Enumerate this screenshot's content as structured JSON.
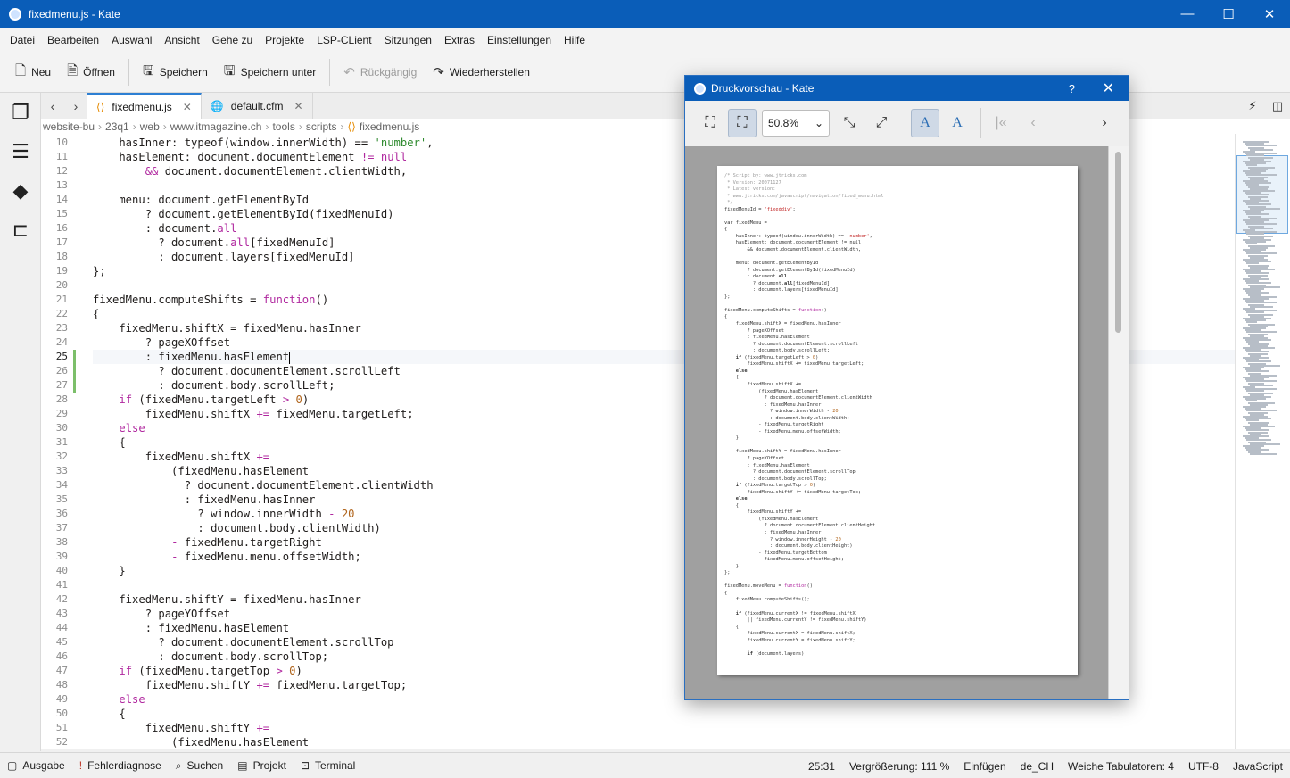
{
  "window": {
    "title": "fixedmenu.js  - Kate",
    "controls": [
      "—",
      "☐",
      "✕"
    ]
  },
  "menu": [
    "Datei",
    "Bearbeiten",
    "Auswahl",
    "Ansicht",
    "Gehe zu",
    "Projekte",
    "LSP-CLient",
    "Sitzungen",
    "Extras",
    "Einstellungen",
    "Hilfe"
  ],
  "toolbar": {
    "new": "Neu",
    "open": "Öffnen",
    "save": "Speichern",
    "save_as": "Speichern unter",
    "undo": "Rückgängig",
    "redo": "Wiederherstellen"
  },
  "tabs": [
    {
      "label": "fixedmenu.js",
      "active": true,
      "icon": "code-file-icon"
    },
    {
      "label": "default.cfm",
      "active": false,
      "icon": "web-file-icon"
    }
  ],
  "breadcrumb": [
    "website-bu",
    "23q1",
    "web",
    "www.itmagazine.ch",
    "tools",
    "scripts",
    "fixedmenu.js"
  ],
  "editor": {
    "current_line": 25,
    "lines": [
      {
        "n": 10,
        "html": "    hasInner: typeof(window.innerWidth) == <span class=\"str\">'number'</span>,"
      },
      {
        "n": 11,
        "html": "    hasElement: document.documentElement <span class=\"kw\">!=</span> <span class=\"kw\">null</span>"
      },
      {
        "n": 12,
        "html": "        <span class=\"kw\">&amp;&amp;</span> document.documentElement.clientWidth,"
      },
      {
        "n": 13,
        "html": ""
      },
      {
        "n": 14,
        "html": "    menu: document.getElementById"
      },
      {
        "n": 15,
        "html": "        ? document.getElementById(fixedMenuId)"
      },
      {
        "n": 16,
        "html": "        : document.<span class=\"kw\">all</span>"
      },
      {
        "n": 17,
        "html": "          ? document.<span class=\"kw\">all</span>[fixedMenuId]"
      },
      {
        "n": 18,
        "html": "          : document.layers[fixedMenuId]"
      },
      {
        "n": 19,
        "html": "};"
      },
      {
        "n": 20,
        "html": ""
      },
      {
        "n": 21,
        "html": "fixedMenu.computeShifts = <span class=\"kw\">function</span>()"
      },
      {
        "n": 22,
        "html": "{"
      },
      {
        "n": 23,
        "html": "    fixedMenu.shiftX = fixedMenu.hasInner"
      },
      {
        "n": 24,
        "html": "        ? pageXOffset"
      },
      {
        "n": 25,
        "html": "        : fixedMenu.hasElement<span class=\"caret\"></span>"
      },
      {
        "n": 26,
        "html": "          ? document.documentElement.scrollLeft"
      },
      {
        "n": 27,
        "html": "          : document.body.scrollLeft;"
      },
      {
        "n": 28,
        "html": "    <span class=\"kw\">if</span> (fixedMenu.targetLeft <span class=\"kw\">&gt;</span> <span class=\"num\">0</span>)"
      },
      {
        "n": 29,
        "html": "        fixedMenu.shiftX <span class=\"kw\">+=</span> fixedMenu.targetLeft;"
      },
      {
        "n": 30,
        "html": "    <span class=\"kw\">else</span>"
      },
      {
        "n": 31,
        "html": "    {"
      },
      {
        "n": 32,
        "html": "        fixedMenu.shiftX <span class=\"kw\">+=</span>"
      },
      {
        "n": 33,
        "html": "            (fixedMenu.hasElement"
      },
      {
        "n": 34,
        "html": "              ? document.documentElement.clientWidth"
      },
      {
        "n": 35,
        "html": "              : fixedMenu.hasInner"
      },
      {
        "n": 36,
        "html": "                ? window.innerWidth <span class=\"kw\">-</span> <span class=\"num\">20</span>"
      },
      {
        "n": 37,
        "html": "                : document.body.clientWidth)"
      },
      {
        "n": 38,
        "html": "            <span class=\"kw\">-</span> fixedMenu.targetRight"
      },
      {
        "n": 39,
        "html": "            <span class=\"kw\">-</span> fixedMenu.menu.offsetWidth;"
      },
      {
        "n": 40,
        "html": "    }"
      },
      {
        "n": 41,
        "html": ""
      },
      {
        "n": 42,
        "html": "    fixedMenu.shiftY = fixedMenu.hasInner"
      },
      {
        "n": 43,
        "html": "        ? pageYOffset"
      },
      {
        "n": 44,
        "html": "        : fixedMenu.hasElement"
      },
      {
        "n": 45,
        "html": "          ? document.documentElement.scrollTop"
      },
      {
        "n": 46,
        "html": "          : document.body.scrollTop;"
      },
      {
        "n": 47,
        "html": "    <span class=\"kw\">if</span> (fixedMenu.targetTop <span class=\"kw\">&gt;</span> <span class=\"num\">0</span>)"
      },
      {
        "n": 48,
        "html": "        fixedMenu.shiftY <span class=\"kw\">+=</span> fixedMenu.targetTop;"
      },
      {
        "n": 49,
        "html": "    <span class=\"kw\">else</span>"
      },
      {
        "n": 50,
        "html": "    {"
      },
      {
        "n": 51,
        "html": "        fixedMenu.shiftY <span class=\"kw\">+=</span>"
      },
      {
        "n": 52,
        "html": "            (fixedMenu.hasElement"
      }
    ]
  },
  "preview": {
    "title": "Druckvorschau - Kate",
    "help": "?",
    "close": "✕",
    "zoom": "50.8%",
    "lines": [
      {
        "c": true,
        "html": "/* Script by: www.jtricks.com"
      },
      {
        "c": true,
        "html": " * Version: 20071127"
      },
      {
        "c": true,
        "html": " * Latest version:"
      },
      {
        "c": true,
        "html": " * www.jtricks.com/javascript/navigation/fixed_menu.html"
      },
      {
        "c": true,
        "html": " */"
      },
      {
        "html": "fixedMenuId = <span class=\"str\">'fixeddiv'</span>;"
      },
      {
        "html": ""
      },
      {
        "html": "var fixedMenu ="
      },
      {
        "html": "{"
      },
      {
        "html": "    hasInner: typeof(window.innerWidth) == <span class=\"str\">'number'</span>,"
      },
      {
        "html": "    hasElement: document.documentElement != null"
      },
      {
        "html": "        &amp;&amp; document.documentElement.clientWidth,"
      },
      {
        "html": ""
      },
      {
        "html": "    menu: document.getElementById"
      },
      {
        "html": "        ? document.getElementById(fixedMenuId)"
      },
      {
        "html": "        : document.<b>all</b>"
      },
      {
        "html": "          ? document.<b>all</b>[fixedMenuId]"
      },
      {
        "html": "          : document.layers[fixedMenuId]"
      },
      {
        "html": "};"
      },
      {
        "html": ""
      },
      {
        "html": "fixedMenu.computeShifts = <span class=\"kw\">function</span>()"
      },
      {
        "html": "{"
      },
      {
        "html": "    fixedMenu.shiftX = fixedMenu.hasInner"
      },
      {
        "html": "        ? pageXOffset"
      },
      {
        "html": "        : fixedMenu.hasElement"
      },
      {
        "html": "          ? document.documentElement.scrollLeft"
      },
      {
        "html": "          : document.body.scrollLeft;"
      },
      {
        "html": "    <b>if</b> (fixedMenu.targetLeft &gt; <span class=\"num\">0</span>)"
      },
      {
        "html": "        fixedMenu.shiftX += fixedMenu.targetLeft;"
      },
      {
        "html": "    <b>else</b>"
      },
      {
        "html": "    {"
      },
      {
        "html": "        fixedMenu.shiftX +="
      },
      {
        "html": "            (fixedMenu.hasElement"
      },
      {
        "html": "              ? document.documentElement.clientWidth"
      },
      {
        "html": "              : fixedMenu.hasInner"
      },
      {
        "html": "                ? window.innerWidth - <span class=\"num\">20</span>"
      },
      {
        "html": "                : document.body.clientWidth)"
      },
      {
        "html": "            - fixedMenu.targetRight"
      },
      {
        "html": "            - fixedMenu.menu.offsetWidth;"
      },
      {
        "html": "    }"
      },
      {
        "html": ""
      },
      {
        "html": "    fixedMenu.shiftY = fixedMenu.hasInner"
      },
      {
        "html": "        ? pageYOffset"
      },
      {
        "html": "        : fixedMenu.hasElement"
      },
      {
        "html": "          ? document.documentElement.scrollTop"
      },
      {
        "html": "          : document.body.scrollTop;"
      },
      {
        "html": "    <b>if</b> (fixedMenu.targetTop &gt; <span class=\"num\">0</span>)"
      },
      {
        "html": "        fixedMenu.shiftY += fixedMenu.targetTop;"
      },
      {
        "html": "    <b>else</b>"
      },
      {
        "html": "    {"
      },
      {
        "html": "        fixedMenu.shiftY +="
      },
      {
        "html": "            (fixedMenu.hasElement"
      },
      {
        "html": "              ? document.documentElement.clientHeight"
      },
      {
        "html": "              : fixedMenu.hasInner"
      },
      {
        "html": "                ? window.innerHeight - <span class=\"num\">20</span>"
      },
      {
        "html": "                : document.body.clientHeight)"
      },
      {
        "html": "            - fixedMenu.targetBottom"
      },
      {
        "html": "            - fixedMenu.menu.offsetHeight;"
      },
      {
        "html": "    }"
      },
      {
        "html": "};"
      },
      {
        "html": ""
      },
      {
        "html": "fixedMenu.moveMenu = <span class=\"kw\">function</span>()"
      },
      {
        "html": "{"
      },
      {
        "html": "    fixedMenu.computeShifts();"
      },
      {
        "html": ""
      },
      {
        "html": "    <b>if</b> (fixedMenu.currentX != fixedMenu.shiftX"
      },
      {
        "html": "        || fixedMenu.currentY != fixedMenu.shiftY)"
      },
      {
        "html": "    {"
      },
      {
        "html": "        fixedMenu.currentX = fixedMenu.shiftX;"
      },
      {
        "html": "        fixedMenu.currentY = fixedMenu.shiftY;"
      },
      {
        "html": ""
      },
      {
        "html": "        <b>if</b> (document.layers)"
      }
    ]
  },
  "statusbar": {
    "left": [
      "Ausgabe",
      "Fehlerdiagnose",
      "Suchen",
      "Projekt",
      "Terminal"
    ],
    "position": "25:31",
    "zoom": "Vergrößerung: 111 %",
    "mode": "Einfügen",
    "language_dict": "de_CH",
    "tabs": "Weiche Tabulatoren: 4",
    "encoding": "UTF-8",
    "syntax": "JavaScript"
  }
}
